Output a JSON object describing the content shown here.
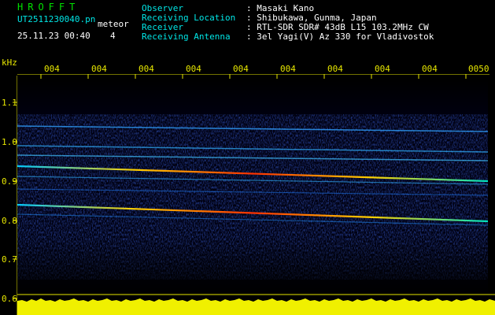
{
  "header": {
    "app_title": "HROFFT",
    "file_name": "UT2511230040.pn",
    "file_tag": "meteor",
    "timestamp": "25.11.23 00:40",
    "count": "4",
    "observer_label": "Observer",
    "observer_value": ": Masaki Kano",
    "location_label": "Receiving Location",
    "location_value": ": Shibukawa, Gunma, Japan",
    "receiver_label": "Receiver",
    "receiver_value": ": RTL-SDR SDR# 43dB L15 103.2MHz CW",
    "antenna_label": "Receiving Antenna",
    "antenna_value": ": 3el Yagi(V) Az 330 for Vladivostok"
  },
  "axis": {
    "freq_unit": "kHz",
    "freq_labels": [
      "1.1",
      "1.0",
      "0.9",
      "0.8",
      "0.7",
      "0.6"
    ],
    "time_ticks": [
      "004",
      "004",
      "004",
      "004",
      "004",
      "004",
      "004",
      "004",
      "004",
      "0050"
    ]
  },
  "colors": {
    "title_green": "#00e000",
    "label_cyan": "#00e6e6",
    "value_white": "#ffffff",
    "axis_yellow": "#e6e600",
    "background": "#000000"
  }
}
